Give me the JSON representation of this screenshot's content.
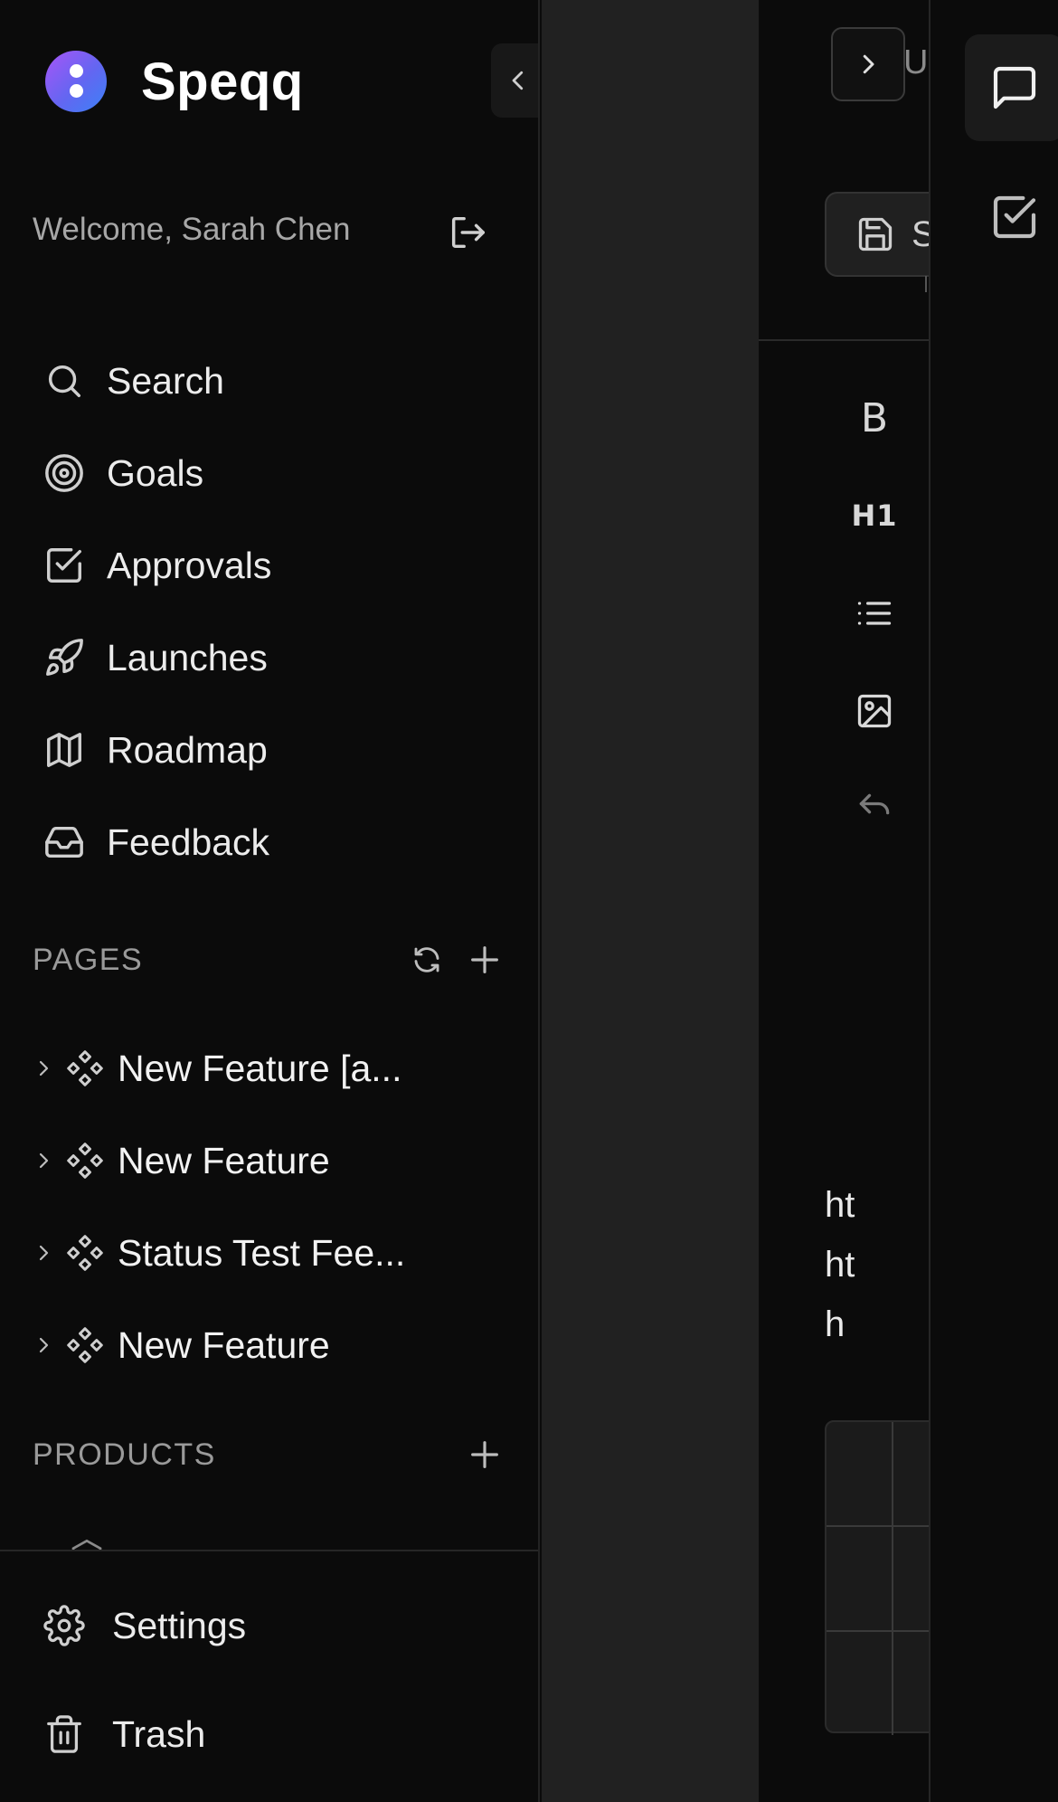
{
  "app": {
    "brand": "Speqq"
  },
  "sidebar": {
    "welcome": "Welcome, Sarah Chen",
    "nav": [
      {
        "label": "Search",
        "icon": "search-icon"
      },
      {
        "label": "Goals",
        "icon": "target-icon"
      },
      {
        "label": "Approvals",
        "icon": "check-square-icon"
      },
      {
        "label": "Launches",
        "icon": "rocket-icon"
      },
      {
        "label": "Roadmap",
        "icon": "map-icon"
      },
      {
        "label": "Feedback",
        "icon": "inbox-icon"
      }
    ],
    "pages_title": "PAGES",
    "pages": [
      {
        "label": "New Feature [a...",
        "icon": "component-icon"
      },
      {
        "label": "New Feature",
        "icon": "component-icon"
      },
      {
        "label": "Status Test Fee...",
        "icon": "component-icon"
      },
      {
        "label": "New Feature",
        "icon": "component-icon"
      }
    ],
    "products_title": "PRODUCTS",
    "footer": [
      {
        "label": "Settings",
        "icon": "gear-icon"
      },
      {
        "label": "Trash",
        "icon": "trash-icon"
      }
    ]
  },
  "editor": {
    "cut_title": "U",
    "save_label": "S",
    "toolbar": [
      {
        "label": "B",
        "icon": "bold-icon"
      },
      {
        "label": "H1",
        "icon": "heading-icon"
      },
      {
        "icon": "list-icon"
      },
      {
        "icon": "image-icon"
      },
      {
        "icon": "undo-icon"
      }
    ],
    "body_lines": [
      "ht",
      "ht",
      "h"
    ]
  },
  "colors": {
    "background": "#0b0b0b",
    "panel_gray": "#212121",
    "brand_gradient_start": "#a855f7",
    "brand_gradient_end": "#3b82f6"
  }
}
